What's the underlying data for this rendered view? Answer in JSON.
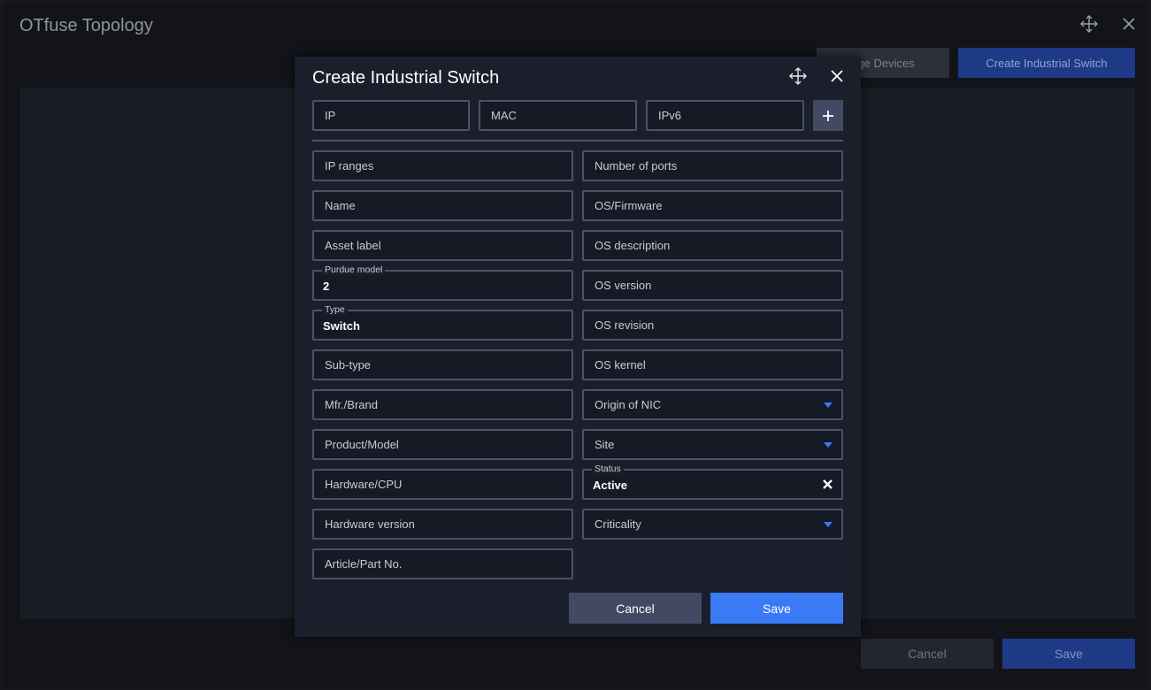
{
  "background": {
    "title": "OTfuse Topology",
    "exchange_button": "nge Devices",
    "create_button": "Create Industrial Switch",
    "cancel_button": "Cancel",
    "save_button": "Save"
  },
  "modal": {
    "title": "Create Industrial Switch",
    "address_fields": {
      "ip": "IP",
      "mac": "MAC",
      "ipv6": "IPv6"
    },
    "left_fields": {
      "ip_ranges": "IP ranges",
      "name": "Name",
      "asset_label": "Asset label",
      "purdue_label": "Purdue model",
      "purdue_value": "2",
      "type_label": "Type",
      "type_value": "Switch",
      "sub_type": "Sub-type",
      "mfr_brand": "Mfr./Brand",
      "product_model": "Product/Model",
      "hardware_cpu": "Hardware/CPU",
      "hardware_version": "Hardware version",
      "article_part": "Article/Part No."
    },
    "right_fields": {
      "number_of_ports": "Number of ports",
      "os_firmware": "OS/Firmware",
      "os_description": "OS description",
      "os_version": "OS version",
      "os_revision": "OS revision",
      "os_kernel": "OS kernel",
      "origin_of_nic": "Origin of NIC",
      "site": "Site",
      "status_label": "Status",
      "status_value": "Active",
      "criticality": "Criticality"
    },
    "cancel_button": "Cancel",
    "save_button": "Save"
  },
  "colors": {
    "accent": "#3a7bf5",
    "modal_bg": "#1b1f2b",
    "field_border": "#4b5366",
    "secondary_button": "#424a63"
  },
  "icons": {
    "move": "move-arrows-icon",
    "close": "close-icon",
    "add": "plus-icon",
    "dropdown": "caret-down-icon",
    "clear": "clear-x-icon"
  }
}
